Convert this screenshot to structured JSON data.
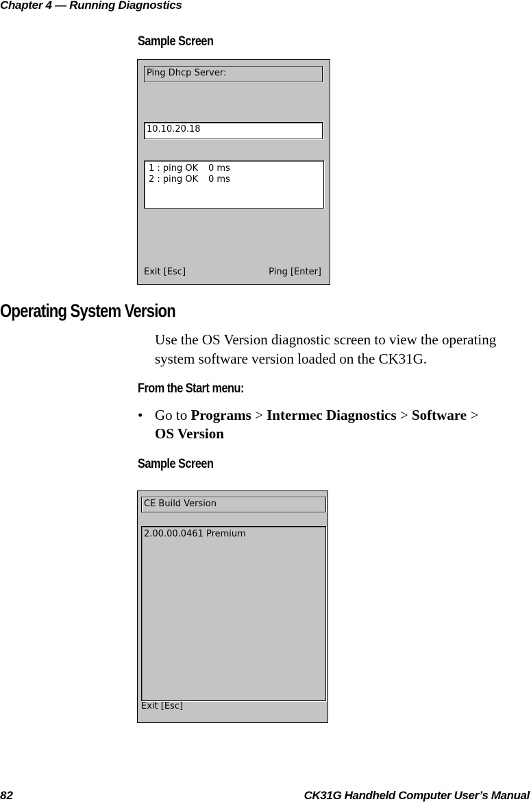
{
  "page": {
    "header": "Chapter 4 — Running Diagnostics",
    "footer_page_number": "82",
    "footer_title": "CK31G Handheld Computer User’s Manual"
  },
  "section1": {
    "subheading": "Sample Screen",
    "screen": {
      "title_label": "Ping Dhcp Server:",
      "address_value": "10.10.20.18",
      "results": [
        {
          "index": "1",
          "status": "ping OK",
          "time": "0 ms"
        },
        {
          "index": "2",
          "status": "ping OK",
          "time": "0 ms"
        }
      ],
      "results_text": [
        "1 : ping OK",
        "2 : ping OK"
      ],
      "results_time": [
        "0 ms",
        "0 ms"
      ],
      "exit_button": "Exit [Esc]",
      "ping_button": "Ping [Enter]"
    }
  },
  "section2": {
    "heading": "Operating System Version",
    "paragraph": "Use the OS Version diagnostic screen to view the operating system software version loaded on the CK31G.",
    "procedure_heading": "From the Start menu:",
    "bullet": {
      "prefix": "Go to",
      "path": [
        "Programs",
        "Intermec Diagnostics",
        "Software",
        "OS Version"
      ],
      "separator": ">"
    },
    "subheading": "Sample Screen",
    "screen": {
      "title_label": "CE Build Version",
      "version_value": "2.00.00.0461 Premium",
      "exit_button": "Exit [Esc]"
    }
  },
  "colors": {
    "screen_background": "#c6c3c6",
    "field_background": "#ffffff",
    "text": "#000000"
  }
}
